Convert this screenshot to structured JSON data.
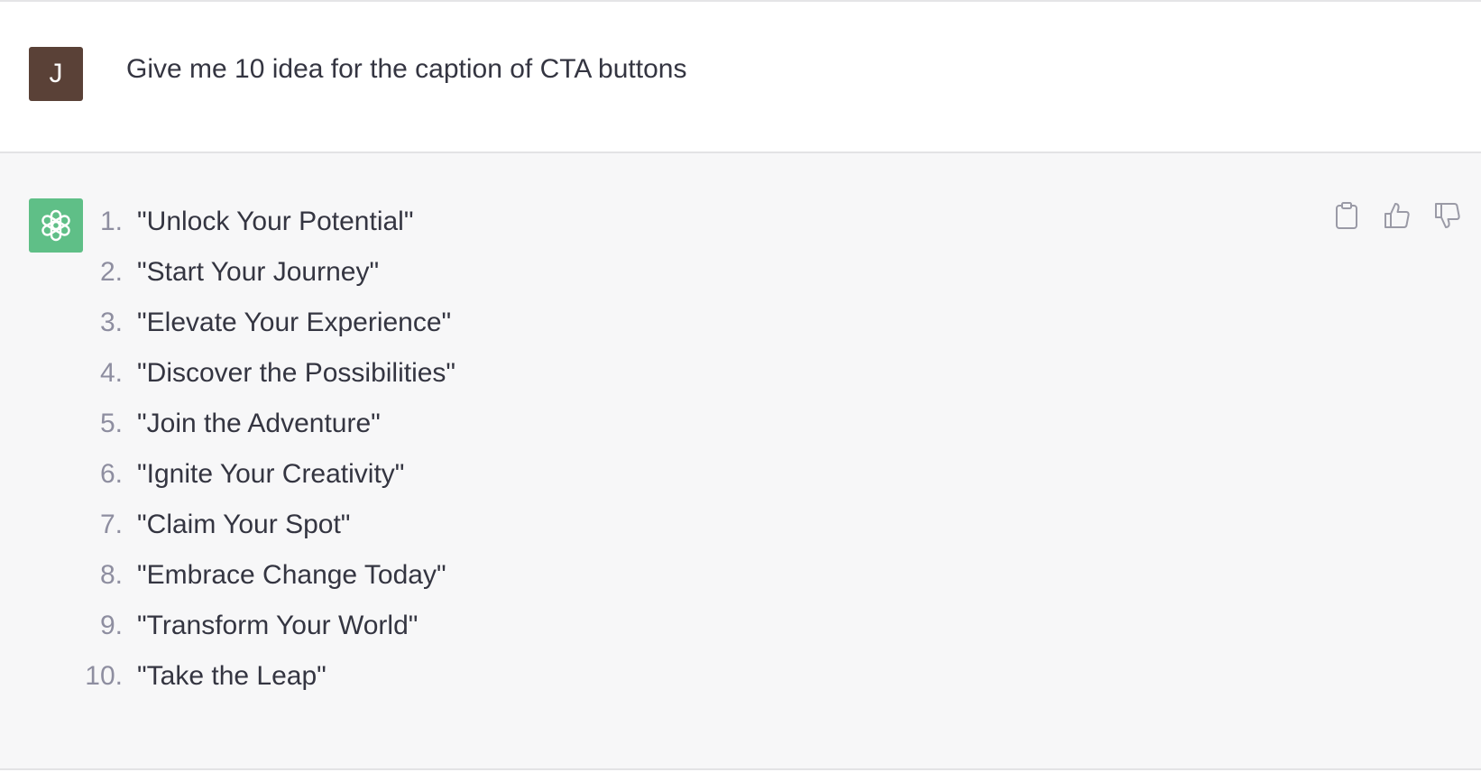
{
  "user": {
    "avatar_letter": "J",
    "avatar_color": "#5a4137",
    "message": "Give me 10 idea for the caption of CTA buttons"
  },
  "assistant": {
    "avatar_icon": "chatgpt-logo-icon",
    "avatar_color": "#5fbf87",
    "items": [
      {
        "num": "1.",
        "text": "\"Unlock Your Potential\""
      },
      {
        "num": "2.",
        "text": "\"Start Your Journey\""
      },
      {
        "num": "3.",
        "text": "\"Elevate Your Experience\""
      },
      {
        "num": "4.",
        "text": "\"Discover the Possibilities\""
      },
      {
        "num": "5.",
        "text": "\"Join the Adventure\""
      },
      {
        "num": "6.",
        "text": "\"Ignite Your Creativity\""
      },
      {
        "num": "7.",
        "text": "\"Claim Your Spot\""
      },
      {
        "num": "8.",
        "text": "\"Embrace Change Today\""
      },
      {
        "num": "9.",
        "text": "\"Transform Your World\""
      },
      {
        "num": "10.",
        "text": "\"Take the Leap\""
      }
    ],
    "actions": [
      {
        "icon": "clipboard-icon"
      },
      {
        "icon": "thumbs-up-icon"
      },
      {
        "icon": "thumbs-down-icon"
      }
    ]
  }
}
